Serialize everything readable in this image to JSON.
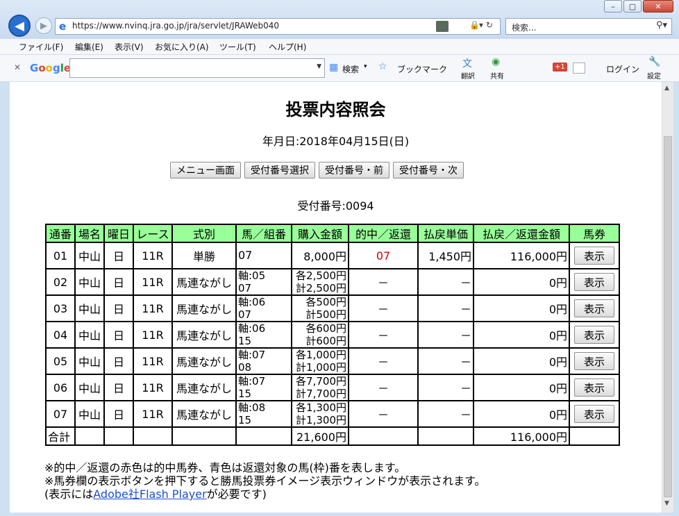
{
  "browser": {
    "url": "https://www.nvinq.jra.go.jp/jra/servlet/JRAWeb040",
    "search_placeholder": "検索...",
    "menu": [
      "ファイル(F)",
      "編集(E)",
      "表示(V)",
      "お気に入り(A)",
      "ツール(T)",
      "ヘルプ(H)"
    ],
    "toolbar": {
      "google": "Google",
      "search": "検索",
      "bookmark": "ブックマーク",
      "translate": "翻訳",
      "share": "共有",
      "gplus": "+1",
      "login": "ログイン",
      "settings": "設定"
    }
  },
  "page": {
    "title": "投票内容照会",
    "date_label": "年月日:2018年04月15日(日)",
    "buttons": [
      "メニュー画面",
      "受付番号選択",
      "受付番号・前",
      "受付番号・次"
    ],
    "receipt_label": "受付番号:0094",
    "table": {
      "headers": [
        "通番",
        "場名",
        "曜日",
        "レース",
        "式別",
        "馬／組番",
        "購入金額",
        "的中／返還",
        "払戻単価",
        "払戻／返還金額",
        "馬券"
      ],
      "rows": [
        {
          "no": "01",
          "place": "中山",
          "day": "日",
          "race": "11R",
          "type": "単勝",
          "combo1": "07",
          "combo2": "",
          "amt1": "8,000円",
          "amt2": "",
          "hit": "07",
          "unit": "1,450円",
          "payout": "116,000円",
          "btn": "表示"
        },
        {
          "no": "02",
          "place": "中山",
          "day": "日",
          "race": "11R",
          "type": "馬連ながし",
          "combo1": "軸:05",
          "combo2": "07",
          "amt1": "各2,500円",
          "amt2": "計2,500円",
          "hit": "－",
          "unit": "－",
          "payout": "0円",
          "btn": "表示"
        },
        {
          "no": "03",
          "place": "中山",
          "day": "日",
          "race": "11R",
          "type": "馬連ながし",
          "combo1": "軸:06",
          "combo2": "07",
          "amt1": "各500円",
          "amt2": "計500円",
          "hit": "－",
          "unit": "－",
          "payout": "0円",
          "btn": "表示"
        },
        {
          "no": "04",
          "place": "中山",
          "day": "日",
          "race": "11R",
          "type": "馬連ながし",
          "combo1": "軸:06",
          "combo2": "15",
          "amt1": "各600円",
          "amt2": "計600円",
          "hit": "－",
          "unit": "－",
          "payout": "0円",
          "btn": "表示"
        },
        {
          "no": "05",
          "place": "中山",
          "day": "日",
          "race": "11R",
          "type": "馬連ながし",
          "combo1": "軸:07",
          "combo2": "08",
          "amt1": "各1,000円",
          "amt2": "計1,000円",
          "hit": "－",
          "unit": "－",
          "payout": "0円",
          "btn": "表示"
        },
        {
          "no": "06",
          "place": "中山",
          "day": "日",
          "race": "11R",
          "type": "馬連ながし",
          "combo1": "軸:07",
          "combo2": "15",
          "amt1": "各7,700円",
          "amt2": "計7,700円",
          "hit": "－",
          "unit": "－",
          "payout": "0円",
          "btn": "表示"
        },
        {
          "no": "07",
          "place": "中山",
          "day": "日",
          "race": "11R",
          "type": "馬連ながし",
          "combo1": "軸:08",
          "combo2": "15",
          "amt1": "各1,300円",
          "amt2": "計1,300円",
          "hit": "－",
          "unit": "－",
          "payout": "0円",
          "btn": "表示"
        }
      ],
      "total": {
        "label": "合計",
        "amount": "21,600円",
        "payout": "116,000円"
      }
    },
    "notes": {
      "line1": "※的中／返還の赤色は的中馬券、青色は返還対象の馬(枠)番を表します。",
      "line2": "※馬券欄の表示ボタンを押下すると勝馬投票券イメージ表示ウィンドウが表示されます。",
      "line3_pre": "(表示には",
      "line3_link": "Adobe社Flash Player",
      "line3_post": "が必要です)"
    }
  },
  "colors": {
    "header_bg": "#99ff99",
    "hit_red": "#cc0000",
    "link_blue": "#1a4fcf"
  }
}
